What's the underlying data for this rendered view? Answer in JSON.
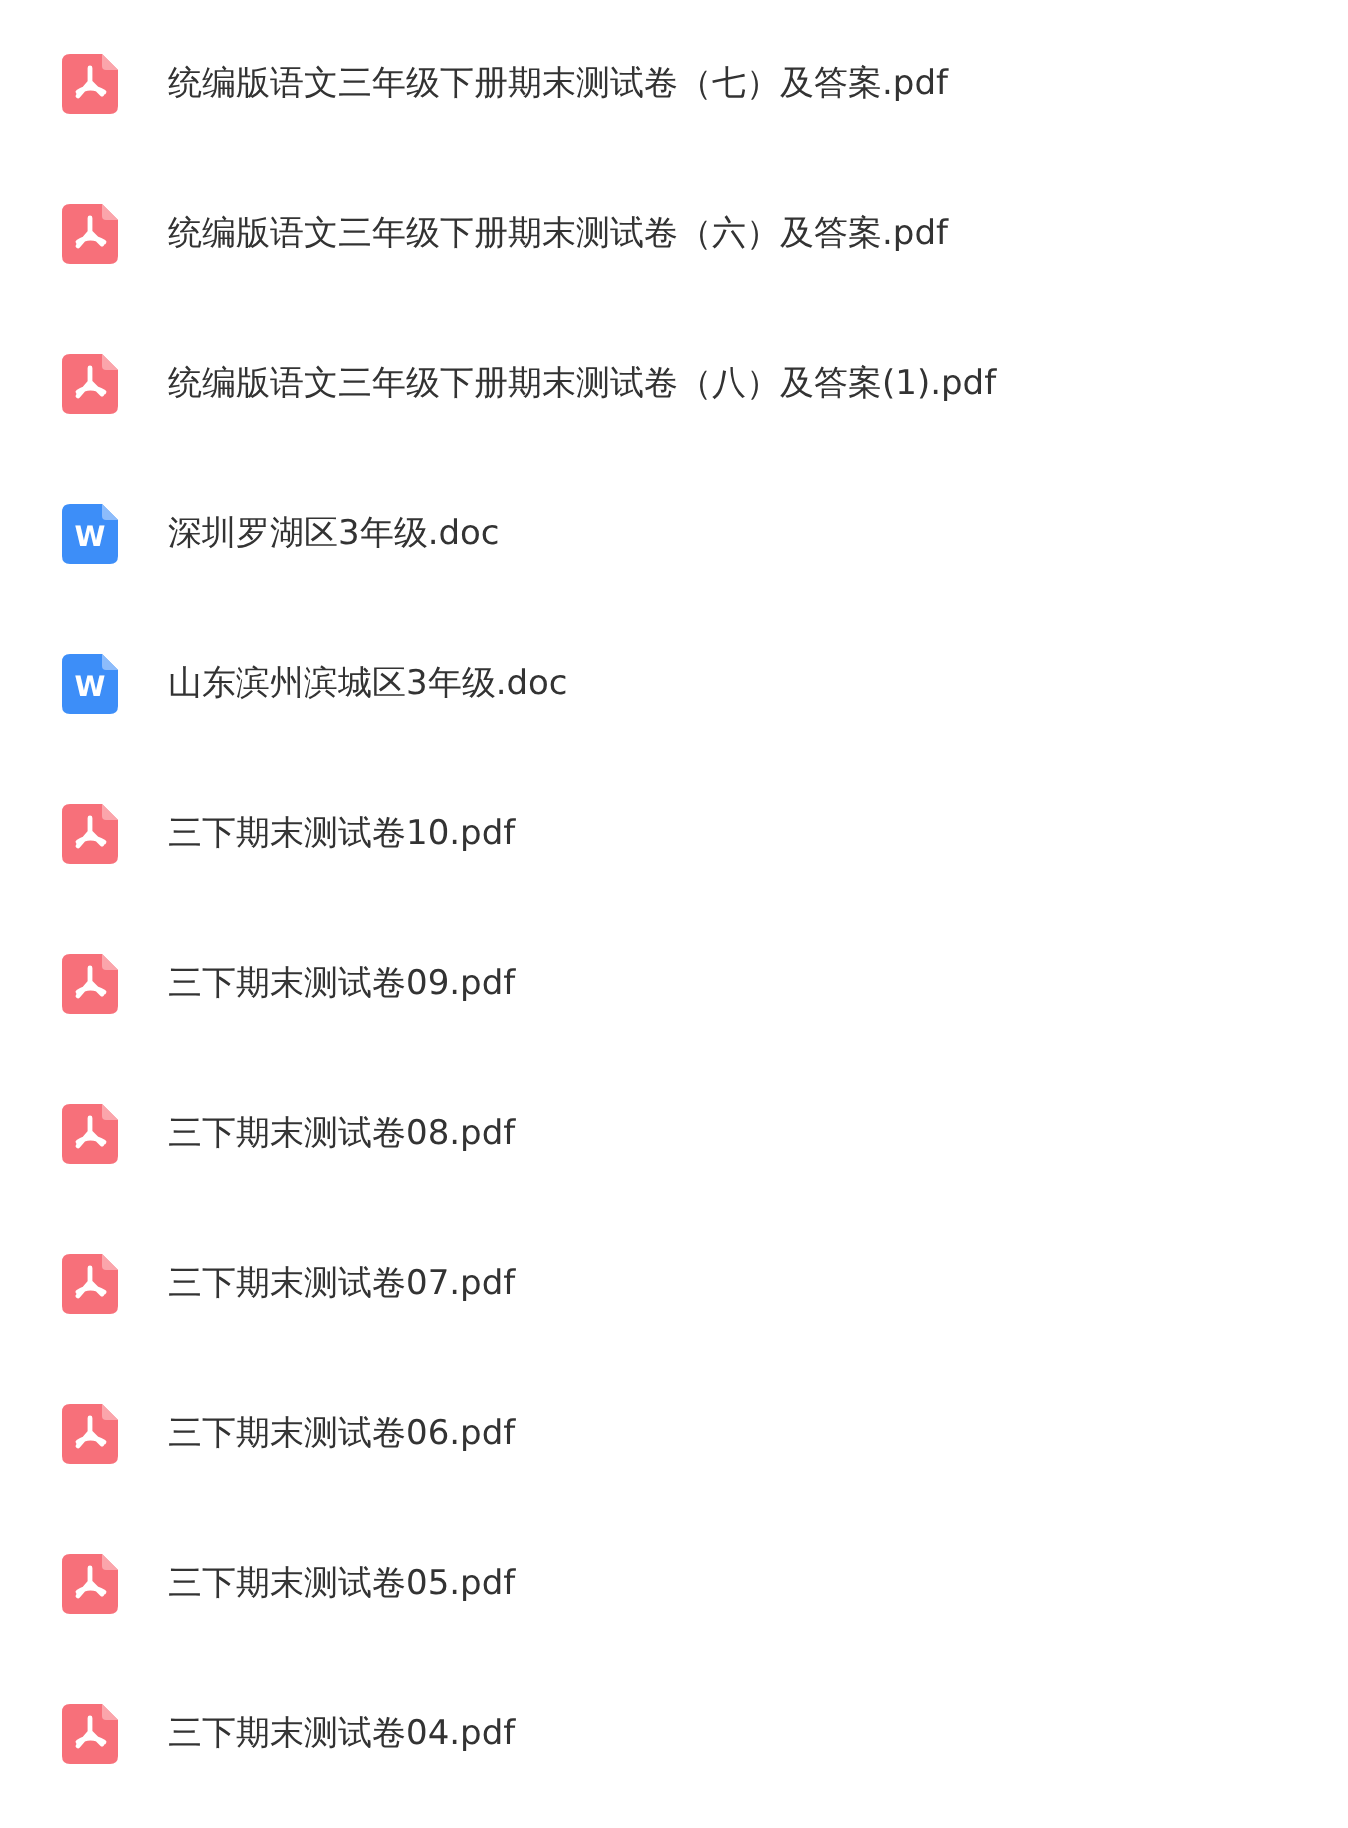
{
  "files": [
    {
      "kind": "pdf",
      "name": "统编版语文三年级下册期末测试卷（七）及答案.pdf"
    },
    {
      "kind": "pdf",
      "name": "统编版语文三年级下册期末测试卷（六）及答案.pdf"
    },
    {
      "kind": "pdf",
      "name": "统编版语文三年级下册期末测试卷（八）及答案(1).pdf"
    },
    {
      "kind": "doc",
      "icon_letter": "W",
      "name": "深圳罗湖区3年级.doc"
    },
    {
      "kind": "doc",
      "icon_letter": "W",
      "name": "山东滨州滨城区3年级.doc"
    },
    {
      "kind": "pdf",
      "name": "三下期末测试卷10.pdf"
    },
    {
      "kind": "pdf",
      "name": "三下期末测试卷09.pdf"
    },
    {
      "kind": "pdf",
      "name": "三下期末测试卷08.pdf"
    },
    {
      "kind": "pdf",
      "name": "三下期末测试卷07.pdf"
    },
    {
      "kind": "pdf",
      "name": "三下期末测试卷06.pdf"
    },
    {
      "kind": "pdf",
      "name": "三下期末测试卷05.pdf"
    },
    {
      "kind": "pdf",
      "name": "三下期末测试卷04.pdf"
    }
  ]
}
